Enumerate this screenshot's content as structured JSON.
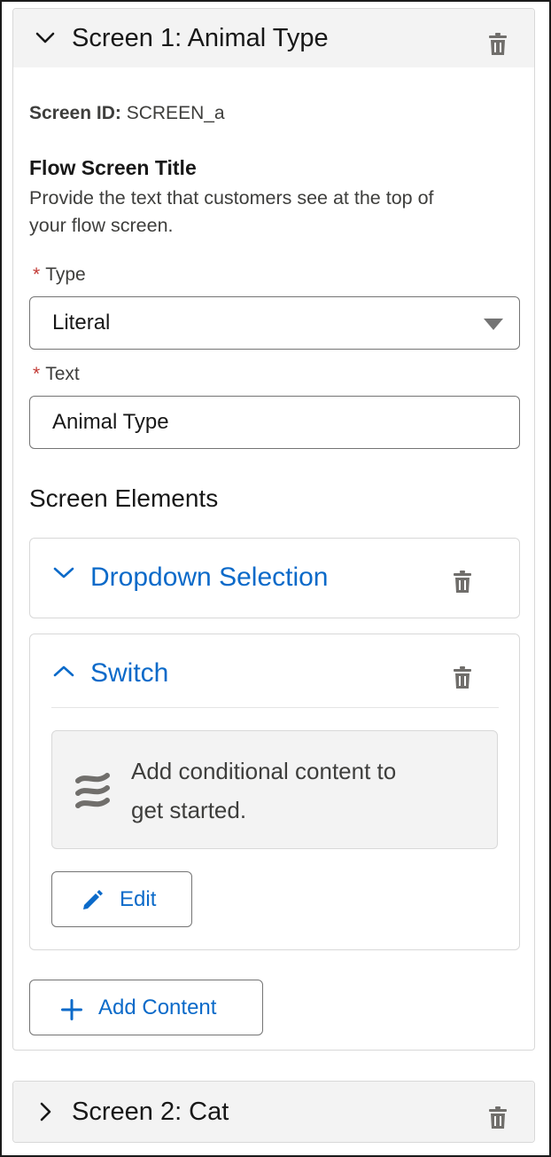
{
  "screen1": {
    "title": "Screen 1: Animal Type",
    "screen_id_label": "Screen ID:",
    "screen_id_value": "SCREEN_a",
    "flow_title_heading": "Flow Screen Title",
    "flow_title_help_line1": "Provide the text that customers see at the top of",
    "flow_title_help_line2": "your flow screen.",
    "type_label": "Type",
    "type_value": "Literal",
    "text_label": "Text",
    "text_value": "Animal Type",
    "required_mark": "*",
    "elements_heading": "Screen Elements",
    "elements": {
      "dropdown": {
        "title": "Dropdown Selection"
      },
      "switch": {
        "title": "Switch",
        "empty_line1": "Add conditional content to",
        "empty_line2": "get started.",
        "edit_label": "Edit"
      }
    },
    "add_content_label": "Add Content"
  },
  "screen2": {
    "title": "Screen 2: Cat"
  },
  "colors": {
    "accent": "#0b6ac9",
    "required": "#c23934",
    "header_bg": "#f3f3f3",
    "border": "#d8d8d8"
  }
}
